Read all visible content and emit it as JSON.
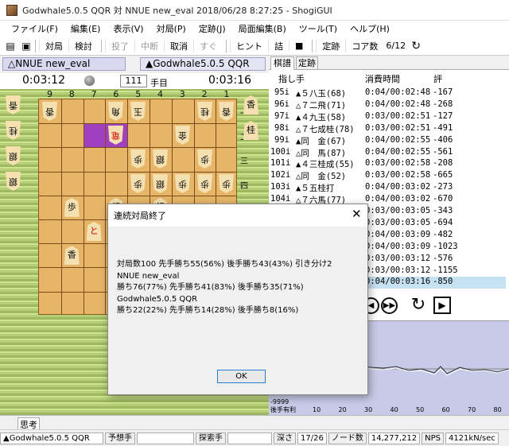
{
  "window": {
    "title": "Godwhale5.0.5 QQR 対 NNUE new_eval 2018/06/28 8:27:25 - ShogiGUI"
  },
  "menu": [
    "ファイル(F)",
    "編集(E)",
    "表示(V)",
    "対局(P)",
    "定跡(J)",
    "局面編集(B)",
    "ツール(T)",
    "ヘルプ(H)"
  ],
  "toolbar": {
    "play": "対局",
    "study": "検討",
    "resign": "投了",
    "suspend": "中断",
    "cancel": "取消",
    "immediate": "すぐ",
    "hint": "ヒント",
    "mate": "詰",
    "stop": "■",
    "joseki": "定跡",
    "cores_label": "コア数",
    "cores": "6/12"
  },
  "players": {
    "sente": "△NNUE new_eval",
    "gote": "▲Godwhale5.0.5 QQR"
  },
  "clock": {
    "time_left": "0:03:12",
    "time_right": "0:03:16",
    "move_number": "111",
    "move_suffix": "手目"
  },
  "board": {
    "files": [
      "9",
      "8",
      "7",
      "6",
      "5",
      "4",
      "3",
      "2",
      "1"
    ],
    "ranks": [
      "一",
      "二",
      "三",
      "四"
    ],
    "pieces": [
      {
        "c": "香",
        "f": 9,
        "r": 1,
        "g": true
      },
      {
        "c": "角",
        "f": 6,
        "r": 1,
        "g": true
      },
      {
        "c": "玉",
        "f": 5,
        "r": 1,
        "g": true
      },
      {
        "c": "桂",
        "f": 2,
        "r": 1,
        "g": true
      },
      {
        "c": "香",
        "f": 1,
        "r": 1,
        "g": true
      },
      {
        "c": "竜",
        "f": 6,
        "r": 2,
        "g": true,
        "red": true
      },
      {
        "c": "金",
        "f": 3,
        "r": 2,
        "g": true
      },
      {
        "c": "歩",
        "f": 5,
        "r": 3,
        "g": true
      },
      {
        "c": "銀",
        "f": 4,
        "r": 3,
        "g": true
      },
      {
        "c": "歩",
        "f": 2,
        "r": 3,
        "g": true
      },
      {
        "c": "歩",
        "f": 5,
        "r": 4,
        "g": true
      },
      {
        "c": "銀",
        "f": 4,
        "r": 4,
        "g": true
      },
      {
        "c": "歩",
        "f": 3,
        "r": 4,
        "g": true
      },
      {
        "c": "歩",
        "f": 2,
        "r": 4,
        "g": true
      },
      {
        "c": "歩",
        "f": 1,
        "r": 4,
        "g": true
      },
      {
        "c": "歩",
        "f": 8,
        "r": 5,
        "g": false
      },
      {
        "c": "銀",
        "f": 6,
        "r": 5,
        "g": false
      },
      {
        "c": "銀",
        "f": 4,
        "r": 5,
        "g": false
      },
      {
        "c": "と",
        "f": 7,
        "r": 6,
        "g": false,
        "red": true
      },
      {
        "c": "香",
        "f": 8,
        "r": 7,
        "g": false
      }
    ],
    "hand_left": [
      "香",
      "桂",
      "銀",
      "銀"
    ],
    "hand_right": [
      "香",
      "桂"
    ]
  },
  "right_tabs": [
    "棋譜",
    "定跡"
  ],
  "movelist": {
    "headers": {
      "move": "指し手",
      "time": "消費時間",
      "eval": "評"
    },
    "rows": [
      {
        "n": "95i",
        "mv": "▲５八玉(68)",
        "t": "0:04/00:02:48",
        "e": "-167"
      },
      {
        "n": "96i",
        "mv": "△７二飛(71)",
        "t": "0:04/00:02:48",
        "e": "-268"
      },
      {
        "n": "97i",
        "mv": "▲４九玉(58)",
        "t": "0:03/00:02:51",
        "e": "-127"
      },
      {
        "n": "98i",
        "mv": "△７七成桂(78)",
        "t": "0:03/00:02:51",
        "e": "-491"
      },
      {
        "n": "99i",
        "mv": "▲同　金(67)",
        "t": "0:04/00:02:55",
        "e": "-406"
      },
      {
        "n": "100i",
        "mv": "△同　馬(87)",
        "t": "0:04/00:02:55",
        "e": "-561"
      },
      {
        "n": "101i",
        "mv": "▲４三桂成(55)",
        "t": "0:03/00:02:58",
        "e": "-208"
      },
      {
        "n": "102i",
        "mv": "△同　金(52)",
        "t": "0:03/00:02:58",
        "e": "-665"
      },
      {
        "n": "103i",
        "mv": "▲５五桂打",
        "t": "0:04/00:03:02",
        "e": "-273"
      },
      {
        "n": "104i",
        "mv": "△７六馬(77)",
        "t": "0:04/00:03:02",
        "e": "-670"
      },
      {
        "n": "",
        "mv": "",
        "t": "0:03/00:03:05",
        "e": "-343"
      },
      {
        "n": "",
        "mv": "",
        "t": "0:03/00:03:05",
        "e": "-694"
      },
      {
        "n": "",
        "mv": "",
        "t": "0:04/00:03:09",
        "e": "-482"
      },
      {
        "n": "",
        "mv": "",
        "t": "0:04/00:03:09",
        "e": "-1023"
      },
      {
        "n": "",
        "mv": "",
        "t": "0:03/00:03:12",
        "e": "-576"
      },
      {
        "n": "",
        "mv": "",
        "t": "0:03/00:03:12",
        "e": "-1155"
      },
      {
        "n": "",
        "mv": "",
        "t": "0:04/00:03:16",
        "e": "-850"
      }
    ]
  },
  "graph": {
    "y_min_label": "-9999",
    "x_axis_label": "後手有利",
    "x_ticks": [
      "10",
      "20",
      "30",
      "40",
      "50",
      "60",
      "70",
      "80"
    ]
  },
  "dialog": {
    "title": "連続対局終了",
    "summary": "対局数100 先手勝ち55(56%) 後手勝ち43(43%) 引き分け2",
    "p1_name": "NNUE new_eval",
    "p1_stats": "勝ち76(77%) 先手勝ち41(83%) 後手勝ち35(71%)",
    "p2_name": "Godwhale5.0.5 QQR",
    "p2_stats": "勝ち22(22%) 先手勝ち14(28%) 後手勝ち8(16%)",
    "ok": "OK"
  },
  "bottom_tab": "思考",
  "status": {
    "engine": "▲Godwhale5.0.5 QQR",
    "pred_label": "予想手",
    "search_label": "探索手",
    "depth_label": "深さ",
    "depth": "17/26",
    "nodes_label": "ノード数",
    "nodes": "14,277,212",
    "nps_label": "NPS",
    "nps": "4121kN/sec"
  }
}
